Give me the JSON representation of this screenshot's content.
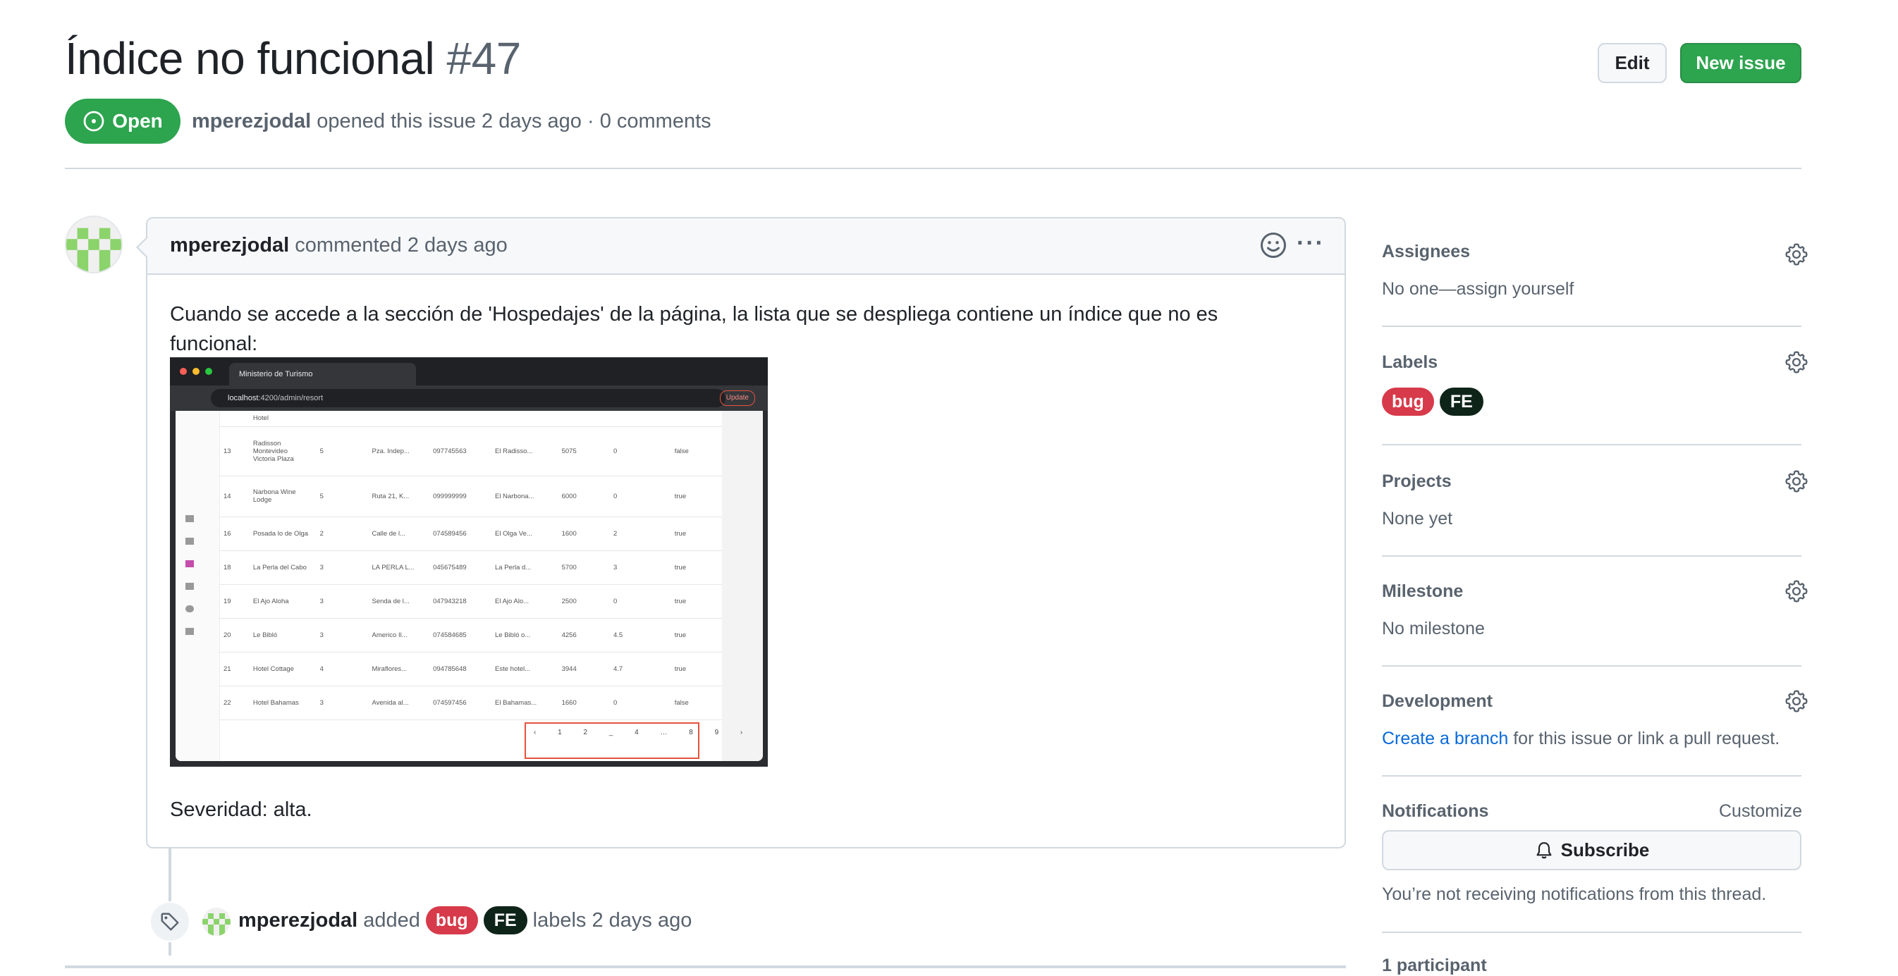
{
  "issue": {
    "title": "Índice no funcional",
    "number": "#47",
    "state": "Open",
    "author": "mperezjodal",
    "meta_rest": "opened this issue 2 days ago · 0 comments"
  },
  "header_buttons": {
    "edit": "Edit",
    "new_issue": "New issue"
  },
  "comment": {
    "author": "mperezjodal",
    "action": "commented 2 days ago",
    "body": "Cuando se accede a la sección de 'Hospedajes' de la página, la lista que se despliega contiene un índice que no es funcional:",
    "severity": "Severidad: alta."
  },
  "screenshot": {
    "tab_title": "Ministerio de Turismo",
    "url_host": "localhost",
    "url_path": ":4200/admin/resort",
    "update_label": "Update",
    "rows": [
      [
        "",
        "Hotel",
        "",
        "",
        "",
        "",
        "",
        "",
        ""
      ],
      [
        "13",
        "Radisson Montevideo Victoria Plaza",
        "5",
        "Pza. Indep...",
        "097745563",
        "El Radisso...",
        "5075",
        "0",
        "false"
      ],
      [
        "14",
        "Narbona Wine Lodge",
        "5",
        "Ruta 21, K...",
        "099999999",
        "El Narbona...",
        "6000",
        "0",
        "true"
      ],
      [
        "16",
        "Posada lo de Olga",
        "2",
        "Calle de l...",
        "074589456",
        "El Olga Ve...",
        "1600",
        "2",
        "true"
      ],
      [
        "18",
        "La Perla del Cabo",
        "3",
        "LA PERLA L...",
        "045675489",
        "La Perla d...",
        "5700",
        "3",
        "true"
      ],
      [
        "19",
        "El Ajo Aloha",
        "3",
        "Senda de l...",
        "047943218",
        "El Ajo Alo...",
        "2500",
        "0",
        "true"
      ],
      [
        "20",
        "Le Bibló",
        "3",
        "Americo Il...",
        "074584685",
        "Le Bibló o...",
        "4256",
        "4.5",
        "true"
      ],
      [
        "21",
        "Hotel Cottage",
        "4",
        "Miraflores...",
        "094785648",
        "Este hotel...",
        "3944",
        "4.7",
        "true"
      ],
      [
        "22",
        "Hotel Bahamas",
        "3",
        "Avenida al...",
        "074597456",
        "El Bahamas...",
        "1660",
        "0",
        "false"
      ]
    ],
    "pager": "‹ 1 2 _ 4 … 8 9 ›"
  },
  "timeline": {
    "author": "mperezjodal",
    "added": "added",
    "labels_text": "labels 2 days ago"
  },
  "sidebar": {
    "assignees": {
      "title": "Assignees",
      "value": "No one—assign yourself"
    },
    "labels": {
      "title": "Labels",
      "items": [
        "bug",
        "FE"
      ]
    },
    "projects": {
      "title": "Projects",
      "value": "None yet"
    },
    "milestone": {
      "title": "Milestone",
      "value": "No milestone"
    },
    "development": {
      "title": "Development",
      "link": "Create a branch",
      "rest": "for this issue or link a pull request."
    },
    "notifications": {
      "title": "Notifications",
      "customize": "Customize",
      "subscribe": "Subscribe",
      "note": "You’re not receiving notifications from this thread."
    },
    "participants": {
      "title": "1 participant"
    }
  },
  "colors": {
    "open_green": "#2da44e",
    "bug_red": "#d73a4a",
    "fe_dark": "#0f2419",
    "link_blue": "#0969da"
  }
}
